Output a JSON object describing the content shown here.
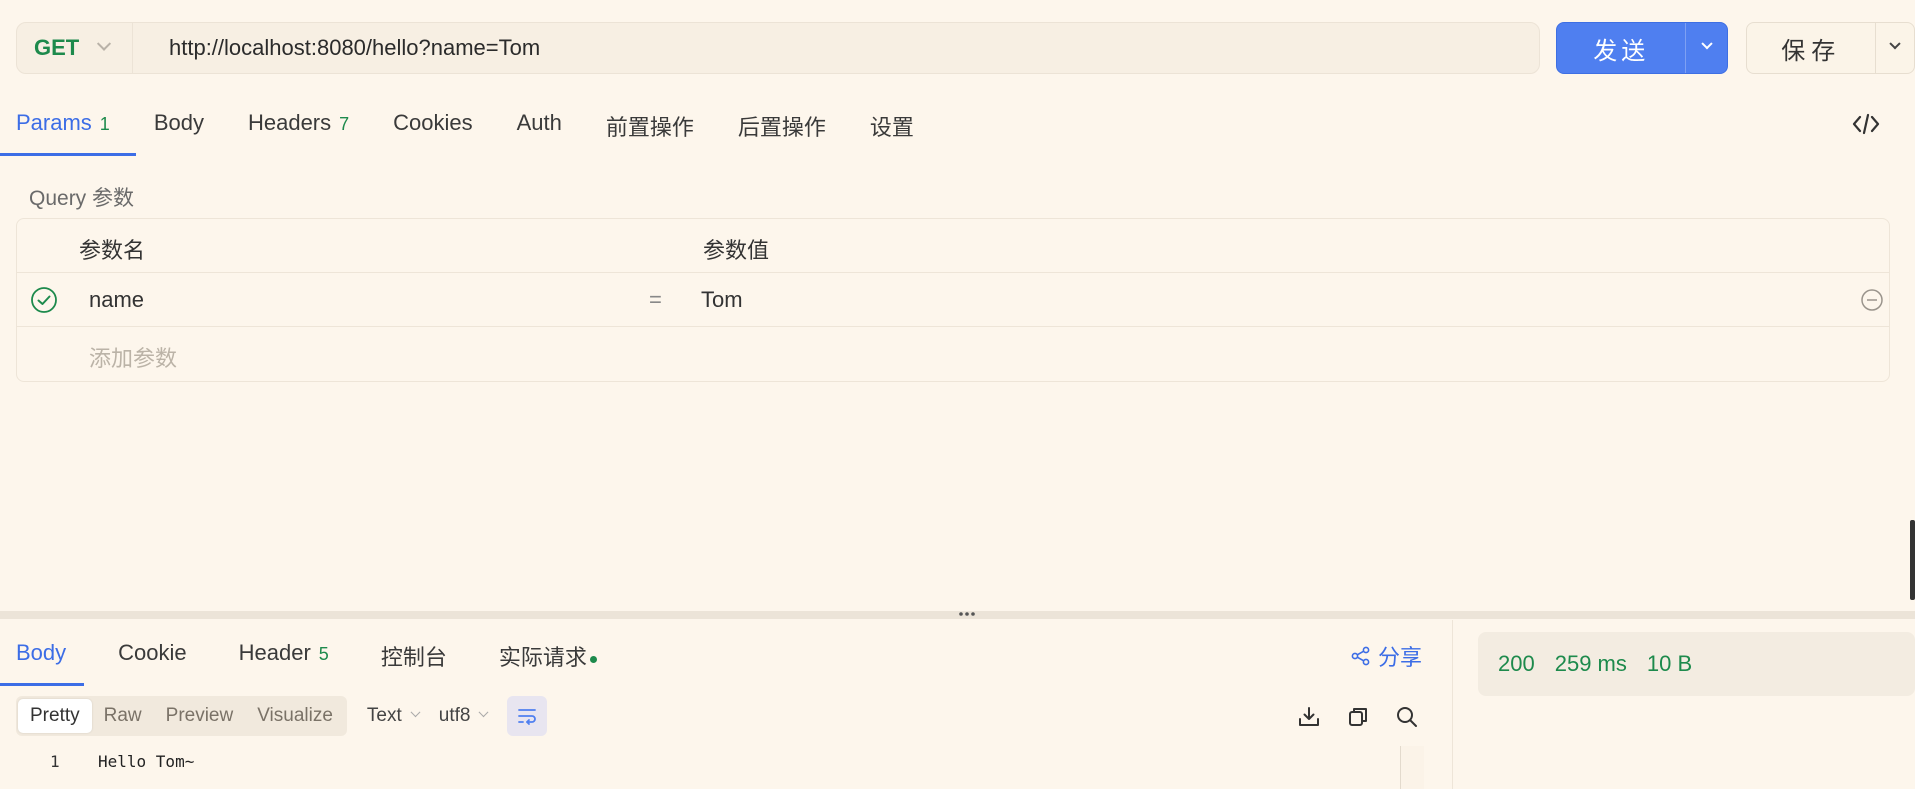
{
  "request": {
    "method": "GET",
    "url": "http://localhost:8080/hello?name=Tom",
    "send_label": "发送",
    "save_label": "保存"
  },
  "request_tabs": [
    {
      "label": "Params",
      "badge": "1",
      "active": true
    },
    {
      "label": "Body",
      "badge": ""
    },
    {
      "label": "Headers",
      "badge": "7"
    },
    {
      "label": "Cookies",
      "badge": ""
    },
    {
      "label": "Auth",
      "badge": ""
    },
    {
      "label": "前置操作",
      "badge": ""
    },
    {
      "label": "后置操作",
      "badge": ""
    },
    {
      "label": "设置",
      "badge": ""
    }
  ],
  "query": {
    "section_label": "Query 参数",
    "header_key": "参数名",
    "header_value": "参数值",
    "rows": [
      {
        "key": "name",
        "value": "Tom",
        "enabled": true
      }
    ],
    "add_placeholder": "添加参数"
  },
  "response_tabs": [
    {
      "label": "Body",
      "badge": "",
      "active": true
    },
    {
      "label": "Cookie",
      "badge": ""
    },
    {
      "label": "Header",
      "badge": "5"
    },
    {
      "label": "控制台",
      "badge": ""
    },
    {
      "label": "实际请求",
      "badge": "",
      "dot": true
    }
  ],
  "share_label": "分享",
  "view_modes": [
    "Pretty",
    "Raw",
    "Preview",
    "Visualize"
  ],
  "format": {
    "type": "Text",
    "encoding": "utf8"
  },
  "editor": {
    "lines": [
      {
        "num": "1",
        "text": "Hello Tom~"
      }
    ]
  },
  "status": {
    "code": "200",
    "time": "259 ms",
    "size": "10 B"
  },
  "colors": {
    "accent": "#3c6de6",
    "success": "#1d8a4c",
    "background": "#fdf6ec"
  }
}
